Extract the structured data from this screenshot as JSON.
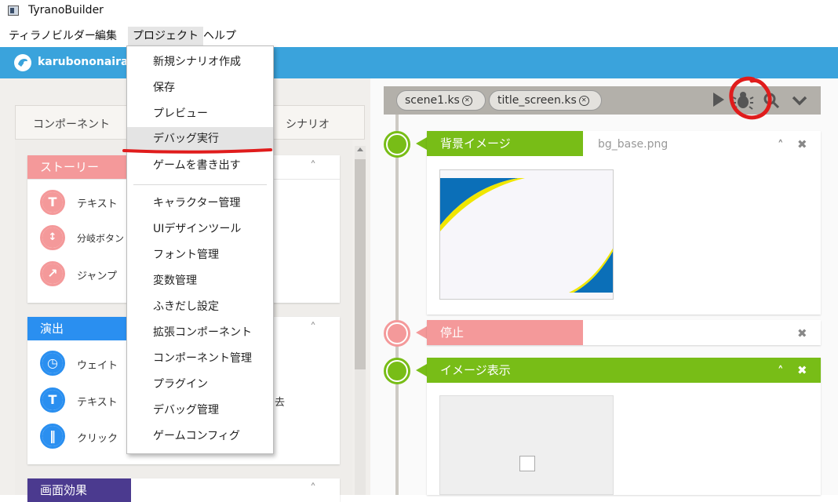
{
  "window": {
    "title": "TyranoBuilder"
  },
  "menubar": {
    "items": [
      "ティラノビルダー",
      "編集",
      "プロジェクト",
      "ヘルプ"
    ]
  },
  "header": {
    "project_name": "karubononairan"
  },
  "left_panel": {
    "tabs": [
      "コンポーネント",
      "シナリオ"
    ],
    "cards": [
      {
        "label": "ストーリー",
        "color": "#f4999a",
        "items": [
          {
            "icon": "text-t-icon",
            "label": "テキスト"
          },
          {
            "icon": "branch-arrows-icon",
            "label": "分岐ボタン"
          },
          {
            "icon": "jump-arrow-icon",
            "label": "ジャンプ"
          }
        ]
      },
      {
        "label": "演出",
        "color": "#2a8ff0",
        "items": [
          {
            "icon": "clock-icon",
            "label": "ウェイト"
          },
          {
            "icon": "text-clear-icon",
            "label": "テキスト"
          },
          {
            "icon": "pause-icon",
            "label": "クリック"
          }
        ],
        "partial_text": "去"
      },
      {
        "label": "画面効果",
        "color": "#4b3a8f",
        "items": []
      }
    ]
  },
  "dropdown": {
    "items": [
      "新規シナリオ作成",
      "保存",
      "プレビュー",
      "デバッグ実行",
      "ゲームを書き出す",
      "キャラクター管理",
      "UIデザインツール",
      "フォント管理",
      "変数管理",
      "ふきだし設定",
      "拡張コンポーネント",
      "コンポーネント管理",
      "プラグイン",
      "デバッグ管理",
      "ゲームコンフィグ"
    ],
    "highlighted": "デバッグ実行"
  },
  "scene_tabs": [
    "scene1.ks",
    "title_screen.ks"
  ],
  "toolbar_icons": [
    "play-icon",
    "bug-icon",
    "search-icon",
    "chevron-down-icon"
  ],
  "timeline": [
    {
      "label": "背景イメージ",
      "value": "bg_base.png",
      "color": "#78bd17",
      "type": "background-image"
    },
    {
      "label": "停止",
      "value": "",
      "color": "#f4999a",
      "type": "stop"
    },
    {
      "label": "イメージ表示",
      "value": "",
      "color": "#78bd17",
      "type": "image-show"
    }
  ],
  "colors": {
    "header_blue": "#3aa3dc",
    "accent_red": "#e01c1c",
    "green": "#78bd17",
    "pink": "#f4999a"
  }
}
